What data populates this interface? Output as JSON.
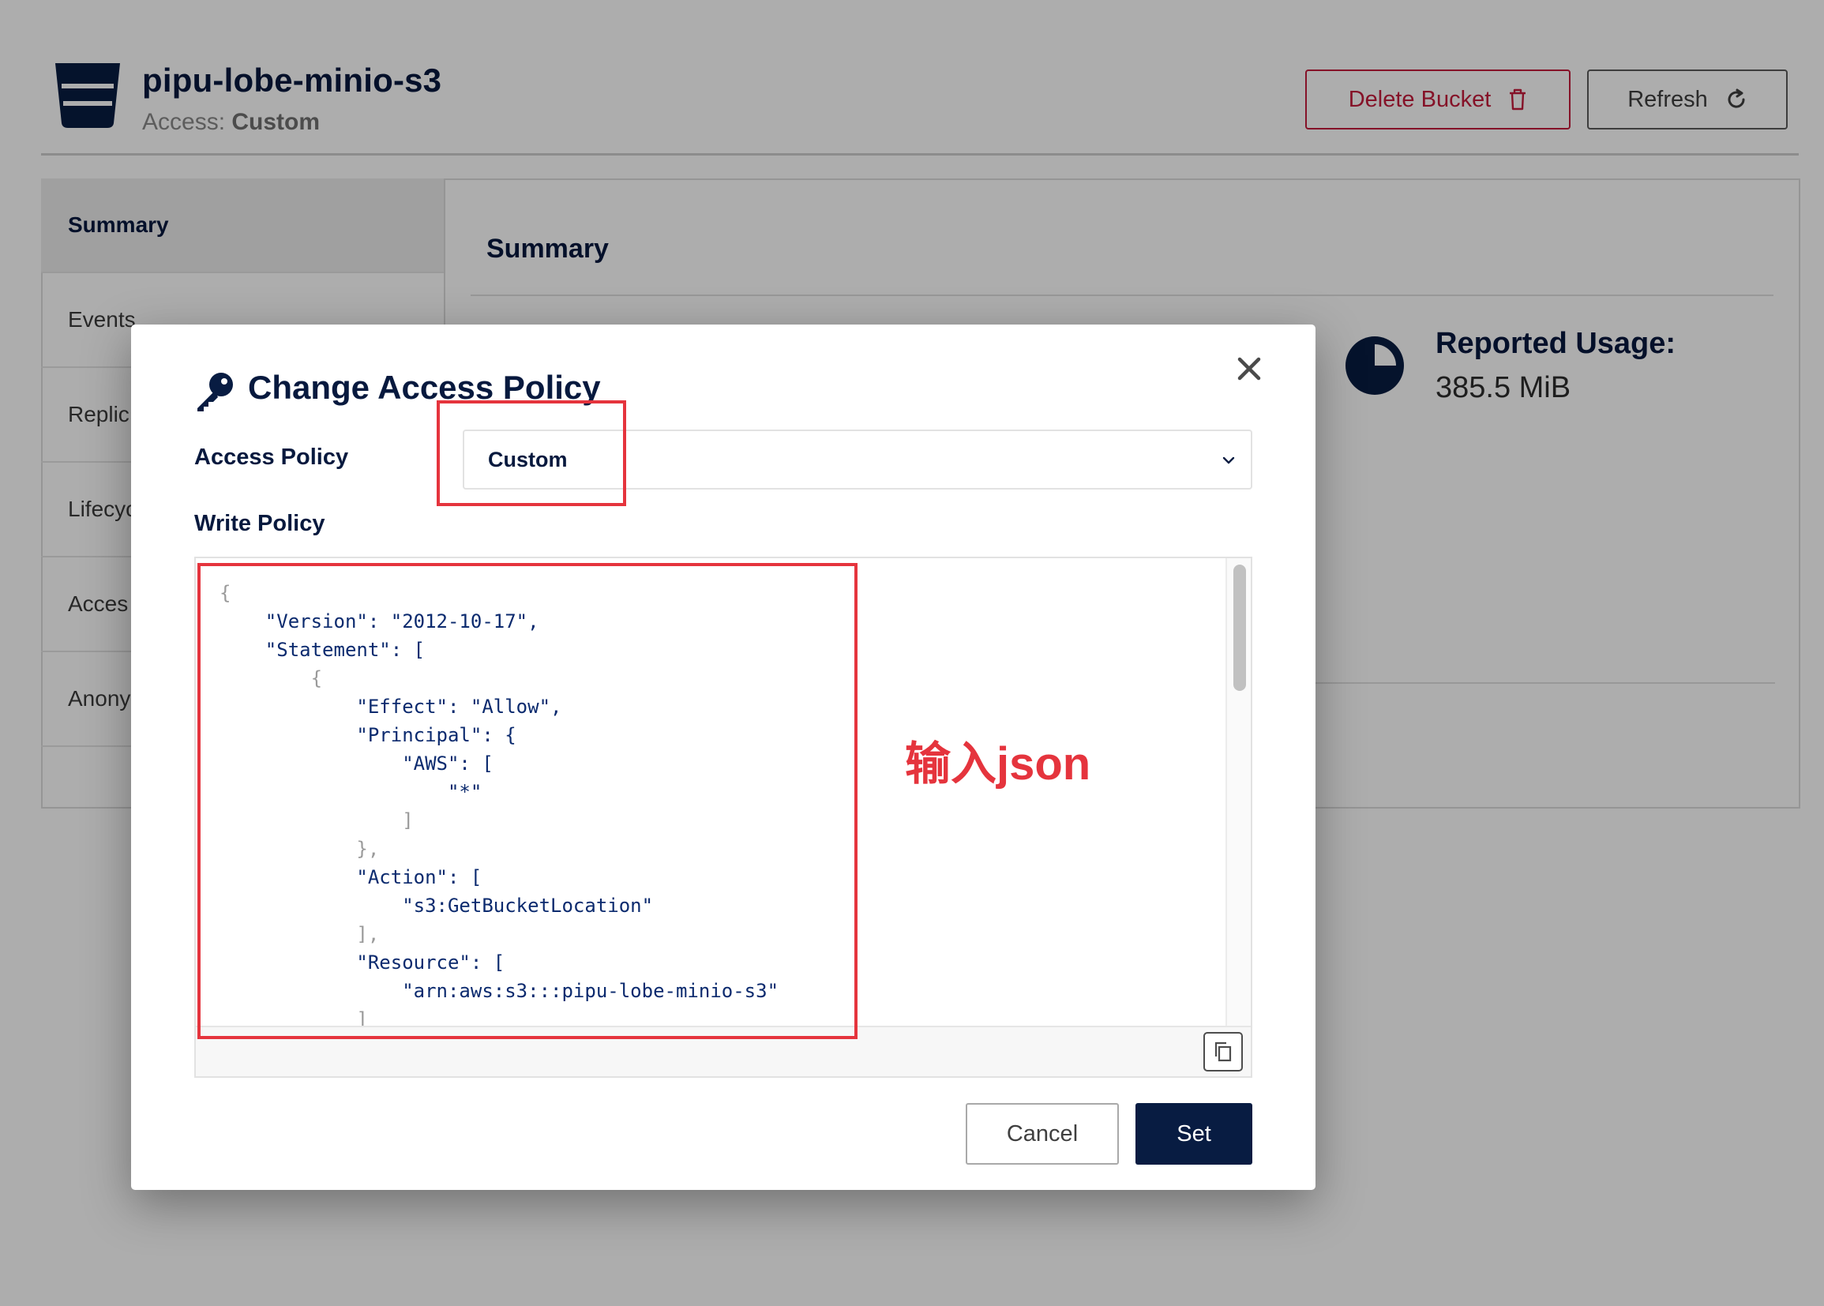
{
  "header": {
    "bucket_name": "pipu-lobe-minio-s3",
    "access_label": "Access:",
    "access_value": "Custom",
    "delete_button": "Delete Bucket",
    "refresh_button": "Refresh"
  },
  "sidebar": {
    "items": [
      {
        "label": "Summary",
        "active": true
      },
      {
        "label": "Events"
      },
      {
        "label": "Replic"
      },
      {
        "label": "Lifecyc"
      },
      {
        "label": "Acces"
      },
      {
        "label": "Anony"
      }
    ]
  },
  "main": {
    "title": "Summary",
    "usage_label": "Reported Usage:",
    "usage_value": "385.5 MiB"
  },
  "modal": {
    "title": "Change Access Policy",
    "access_policy_label": "Access Policy",
    "access_policy_value": "Custom",
    "write_policy_label": "Write Policy",
    "policy_lines": [
      "{",
      "    \"Version\": \"2012-10-17\",",
      "    \"Statement\": [",
      "        {",
      "            \"Effect\": \"Allow\",",
      "            \"Principal\": {",
      "                \"AWS\": [",
      "                    \"*\"",
      "                ]",
      "            },",
      "            \"Action\": [",
      "                \"s3:GetBucketLocation\"",
      "            ],",
      "            \"Resource\": [",
      "                \"arn:aws:s3:::pipu-lobe-minio-s3\"",
      "            ]"
    ],
    "cancel_button": "Cancel",
    "set_button": "Set"
  },
  "annotation": {
    "text": "输入json",
    "color": "#e5343d"
  },
  "colors": {
    "primary": "#081c42",
    "danger": "#c51b3b",
    "annotation": "#e5343d"
  },
  "icons": {
    "bucket": "bucket-icon",
    "trash": "trash-icon",
    "refresh": "refresh-icon",
    "usage": "pie-chart-icon",
    "key": "key-icon",
    "close": "close-icon",
    "chevron": "chevron-down-icon",
    "copy": "copy-icon"
  }
}
